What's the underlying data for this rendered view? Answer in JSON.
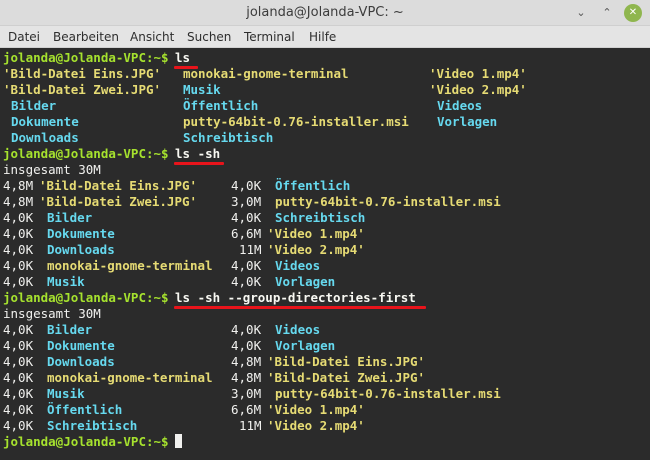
{
  "window": {
    "title": "jolanda@Jolanda-VPC: ~",
    "minimize_glyph": "⌄",
    "maximize_glyph": "⌃",
    "close_glyph": "✕",
    "close_color": "#8fb64e"
  },
  "menu": [
    "Datei",
    "Bearbeiten",
    "Ansicht",
    "Suchen",
    "Terminal",
    "Hilfe"
  ],
  "terminal": {
    "prompt": "jolanda@Jolanda-VPC:~$ ",
    "colors": {
      "prompt": "#a6e22e",
      "file": "#e6db74",
      "dir": "#66d9ef",
      "text": "#f1f1ef",
      "background": "#2b2b2b",
      "annotation": "#e8141b"
    },
    "cmd1": "ls",
    "cmd2": "ls -sh",
    "cmd3": "ls -sh --group-directories-first",
    "ls_rows": [
      [
        "'Bild-Datei Eins.JPG'",
        "monokai-gnome-terminal",
        "'Video 1.mp4'"
      ],
      [
        "'Bild-Datei Zwei.JPG'",
        "Musik",
        "'Video 2.mp4'"
      ],
      [
        "Bilder",
        "Öffentlich",
        "Videos"
      ],
      [
        "Dokumente",
        "putty-64bit-0.76-installer.msi",
        "Vorlagen"
      ],
      [
        "Downloads",
        "Schreibtisch",
        ""
      ]
    ],
    "total": "insgesamt 30M",
    "lssh_rows": [
      [
        "4,8M",
        "'Bild-Datei Eins.JPG'",
        "4,0K",
        "Öffentlich"
      ],
      [
        "4,8M",
        "'Bild-Datei Zwei.JPG'",
        "3,0M",
        "putty-64bit-0.76-installer.msi"
      ],
      [
        "4,0K",
        "Bilder",
        "4,0K",
        "Schreibtisch"
      ],
      [
        "4,0K",
        "Dokumente",
        "6,6M",
        "'Video 1.mp4'"
      ],
      [
        "4,0K",
        "Downloads",
        "11M",
        "'Video 2.mp4'"
      ],
      [
        "4,0K",
        "monokai-gnome-terminal",
        "4,0K",
        "Videos"
      ],
      [
        "4,0K",
        "Musik",
        "4,0K",
        "Vorlagen"
      ]
    ],
    "group_rows": [
      [
        "4,0K",
        "Bilder",
        "4,0K",
        "Videos"
      ],
      [
        "4,0K",
        "Dokumente",
        "4,0K",
        "Vorlagen"
      ],
      [
        "4,0K",
        "Downloads",
        "4,8M",
        "'Bild-Datei Eins.JPG'"
      ],
      [
        "4,0K",
        "monokai-gnome-terminal",
        "4,8M",
        "'Bild-Datei Zwei.JPG'"
      ],
      [
        "4,0K",
        "Musik",
        "3,0M",
        "putty-64bit-0.76-installer.msi"
      ],
      [
        "4,0K",
        "Öffentlich",
        "6,6M",
        "'Video 1.mp4'"
      ],
      [
        "4,0K",
        "Schreibtisch",
        "11M",
        "'Video 2.mp4'"
      ]
    ]
  }
}
